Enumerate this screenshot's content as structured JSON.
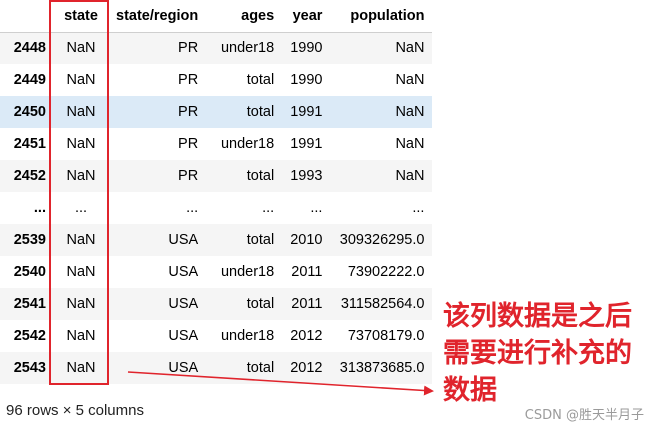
{
  "table": {
    "columns": [
      "",
      "state",
      "state/region",
      "ages",
      "year",
      "population"
    ],
    "rows": [
      [
        "2448",
        "NaN",
        "PR",
        "under18",
        "1990",
        "NaN"
      ],
      [
        "2449",
        "NaN",
        "PR",
        "total",
        "1990",
        "NaN"
      ],
      [
        "2450",
        "NaN",
        "PR",
        "total",
        "1991",
        "NaN"
      ],
      [
        "2451",
        "NaN",
        "PR",
        "under18",
        "1991",
        "NaN"
      ],
      [
        "2452",
        "NaN",
        "PR",
        "total",
        "1993",
        "NaN"
      ],
      [
        "...",
        "...",
        "...",
        "...",
        "...",
        "..."
      ],
      [
        "2539",
        "NaN",
        "USA",
        "total",
        "2010",
        "309326295.0"
      ],
      [
        "2540",
        "NaN",
        "USA",
        "under18",
        "2011",
        "73902222.0"
      ],
      [
        "2541",
        "NaN",
        "USA",
        "total",
        "2011",
        "311582564.0"
      ],
      [
        "2542",
        "NaN",
        "USA",
        "under18",
        "2012",
        "73708179.0"
      ],
      [
        "2543",
        "NaN",
        "USA",
        "total",
        "2012",
        "313873685.0"
      ]
    ],
    "highlighted_row_index": 2
  },
  "footer": {
    "shape_text": "96 rows × 5 columns"
  },
  "annotation": {
    "lines": [
      "该列数据是之后",
      "需要进行补充的",
      "数据"
    ],
    "color": "#e0242c"
  },
  "watermark": "CSDN @胜天半月子"
}
